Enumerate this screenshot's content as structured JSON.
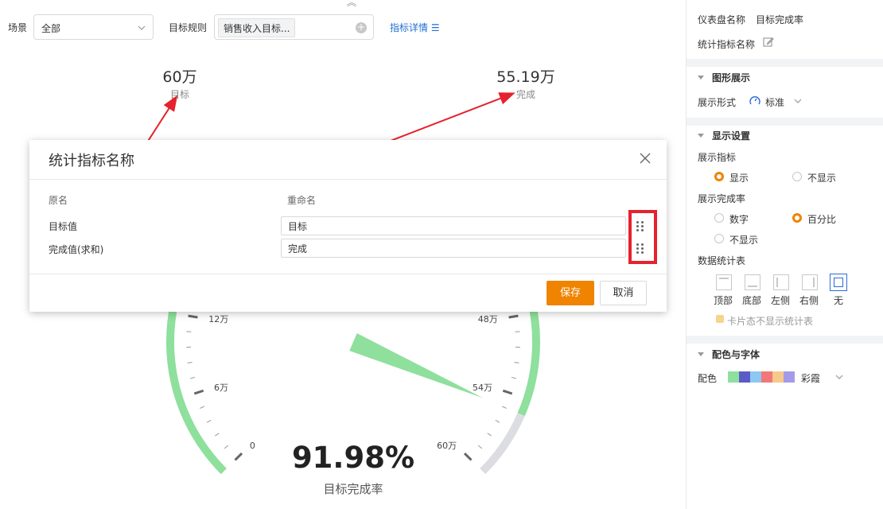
{
  "filters": {
    "scene_label": "场景",
    "scene_value": "全部",
    "rule_label": "目标规则",
    "rule_tag": "销售收入目标...",
    "detail_link": "指标详情"
  },
  "kpis": {
    "target_value": "60万",
    "target_label": "目标",
    "complete_value": "55.19万",
    "complete_label": "完成"
  },
  "gauge": {
    "percent_text": "91.98%",
    "percent": 91.98,
    "label": "目标完成率",
    "ticks": [
      "0",
      "6万",
      "12万",
      "48万",
      "54万",
      "60万"
    ],
    "colors": {
      "fill": "#8ee09c",
      "rest": "#dcdde3",
      "needle": "#8ee09c"
    }
  },
  "modal": {
    "title": "统计指标名称",
    "col_original": "原名",
    "col_rename": "重命名",
    "rows": [
      {
        "original": "目标值",
        "rename": "目标"
      },
      {
        "original": "完成值(求和)",
        "rename": "完成"
      }
    ],
    "save": "保存",
    "cancel": "取消"
  },
  "panel": {
    "dashboard_name_label": "仪表盘名称",
    "dashboard_name_value": "目标完成率",
    "stat_name_label": "统计指标名称",
    "graph_section": "图形展示",
    "display_form_label": "展示形式",
    "display_form_value": "标准",
    "display_section": "显示设置",
    "show_indicator_label": "展示指标",
    "show_opt": "显示",
    "hide_opt": "不显示",
    "show_rate_label": "展示完成率",
    "rate_number": "数字",
    "rate_percent": "百分比",
    "rate_none": "不显示",
    "data_table_label": "数据统计表",
    "pos_top": "顶部",
    "pos_bottom": "底部",
    "pos_left": "左侧",
    "pos_right": "右侧",
    "pos_none": "无",
    "card_hide_stats": "卡片态不显示统计表",
    "color_section": "配色与字体",
    "palette_label": "配色",
    "palette_value": "彩霞",
    "palette_colors": [
      "#8ee09c",
      "#5b5bc8",
      "#8dc8f2",
      "#f07878",
      "#f7c98a",
      "#a59ae8"
    ]
  },
  "accent": {
    "orange": "#f08300",
    "link": "#1f6fd1",
    "annotation_red": "#e5222d"
  }
}
